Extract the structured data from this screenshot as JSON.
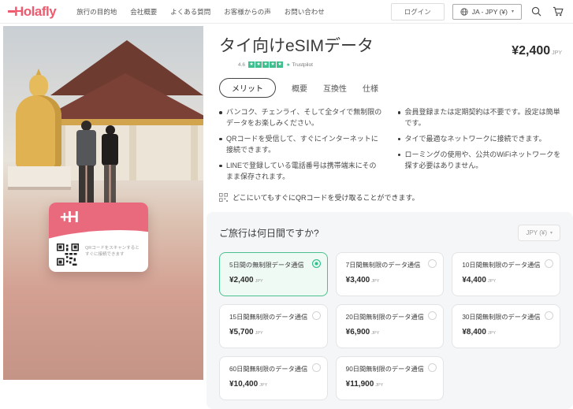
{
  "header": {
    "logo": "Holafly",
    "nav": [
      {
        "label": "旅行の目的地"
      },
      {
        "label": "会社概要"
      },
      {
        "label": "よくある質問"
      },
      {
        "label": "お客様からの声"
      },
      {
        "label": "お問い合わせ"
      }
    ],
    "login_label": "ログイン",
    "locale_label": "JA - JPY (¥)"
  },
  "hero": {
    "qr_card_logo": "+H",
    "qr_card_text": "QRコードをスキャンするとすぐに接続できます"
  },
  "product": {
    "title": "タイ向けeSIMデータ",
    "price": "¥2,400",
    "price_currency": "JPY",
    "rating": {
      "score": "4.6",
      "source": "Trustpilot"
    },
    "tabs": [
      {
        "label": "メリット",
        "active": true
      },
      {
        "label": "概要",
        "active": false
      },
      {
        "label": "互換性",
        "active": false
      },
      {
        "label": "仕様",
        "active": false
      }
    ],
    "benefits_left": [
      "バンコク、チェンライ、そして全タイで無制限のデータをお楽しみください。",
      "QRコードを受信して、すぐにインターネットに接続できます。",
      "LINEで登録している電話番号は携帯端末にそのまま保存されます。"
    ],
    "benefits_right": [
      "会員登録または定期契約は不要です。設定は簡単です。",
      "タイで最適なネットワークに接続できます。",
      "ローミングの使用や、公共のWiFiネットワークを探す必要はありません。"
    ],
    "qr_note": "どこにいてもすぐにQRコードを受け取ることができます。"
  },
  "plans": {
    "heading": "ご旅行は何日間ですか?",
    "currency_selector": "JPY (¥)",
    "options": [
      {
        "label": "5日間の無制限データ通信",
        "price": "¥2,400",
        "currency": "JPY",
        "selected": true
      },
      {
        "label": "7日間無制限のデータ通信",
        "price": "¥3,400",
        "currency": "JPY",
        "selected": false
      },
      {
        "label": "10日間無制限のデータ通信",
        "price": "¥4,400",
        "currency": "JPY",
        "selected": false
      },
      {
        "label": "15日間無制限のデータ通信",
        "price": "¥5,700",
        "currency": "JPY",
        "selected": false
      },
      {
        "label": "20日間無制限のデータ通信",
        "price": "¥6,900",
        "currency": "JPY",
        "selected": false
      },
      {
        "label": "30日間無制限のデータ通信",
        "price": "¥8,400",
        "currency": "JPY",
        "selected": false
      },
      {
        "label": "60日間無制限のデータ通信",
        "price": "¥10,400",
        "currency": "JPY",
        "selected": false
      },
      {
        "label": "90日間無制限のデータ通信",
        "price": "¥11,900",
        "currency": "JPY",
        "selected": false
      }
    ]
  },
  "colors": {
    "brand": "#ef5b6e",
    "card_pink": "#e96a7d",
    "selected_green": "#2fbe8c",
    "panel_gray": "#f5f6f7"
  }
}
